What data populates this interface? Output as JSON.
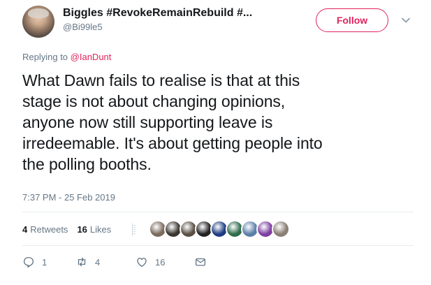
{
  "author": {
    "name": "Biggles #RevokeRemainRebuild #...",
    "handle": "@Bi99le5"
  },
  "follow_label": "Follow",
  "reply": {
    "prefix": "Replying to ",
    "mention": "@IanDunt"
  },
  "body_lines": [
    "What Dawn fails to realise is that at this",
    "stage is not about changing opinions,",
    "anyone now still supporting leave is",
    "irredeemable. It's about getting people into",
    "the polling booths."
  ],
  "timestamp": "7:37 PM - 25 Feb 2019",
  "stats": {
    "retweets_count": "4",
    "retweets_label": "Retweets",
    "likes_count": "16",
    "likes_label": "Likes"
  },
  "liker_colors": [
    "#7a6a5c",
    "#3b3530",
    "#5a4f44",
    "#222222",
    "#1d3c82",
    "#2f6b4a",
    "#5a7fa8",
    "#7d3fa0",
    "#8a7f74"
  ],
  "actions": {
    "reply_count": "1",
    "retweet_count": "4",
    "like_count": "16"
  },
  "icons": {
    "reply": "reply-icon",
    "retweet": "retweet-icon",
    "like": "heart-icon",
    "dm": "envelope-icon",
    "caret": "chevron-down-icon"
  },
  "colors": {
    "accent": "#e0245e",
    "secondary_text": "#657786",
    "primary_text": "#14171a"
  }
}
